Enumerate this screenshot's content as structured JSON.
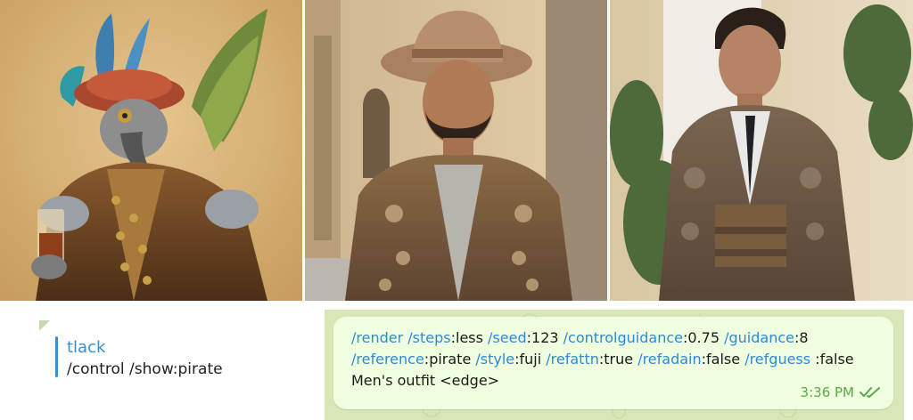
{
  "images": {
    "left": {
      "alt": "pirate-parrot"
    },
    "middle": {
      "alt": "man-with-hat"
    },
    "right": {
      "alt": "man-in-suit"
    }
  },
  "quote": {
    "author": "tlack",
    "text": "/control /show:pirate"
  },
  "message": {
    "parts": [
      {
        "t": "/render ",
        "cmd": true
      },
      {
        "t": "/steps",
        "cmd": true
      },
      {
        "t": ":less ",
        "cmd": false
      },
      {
        "t": "/seed",
        "cmd": true
      },
      {
        "t": ":123 ",
        "cmd": false
      },
      {
        "t": "/controlguidance",
        "cmd": true
      },
      {
        "t": ":0.75 ",
        "cmd": false
      },
      {
        "t": "/guidance",
        "cmd": true
      },
      {
        "t": ":8 ",
        "cmd": false
      },
      {
        "t": "/reference",
        "cmd": true
      },
      {
        "t": ":pirate ",
        "cmd": false
      },
      {
        "t": "/style",
        "cmd": true
      },
      {
        "t": ":fuji ",
        "cmd": false
      },
      {
        "t": "/refattn",
        "cmd": true
      },
      {
        "t": ":true ",
        "cmd": false
      },
      {
        "t": "/refadain",
        "cmd": true
      },
      {
        "t": ":false ",
        "cmd": false
      },
      {
        "t": "/refguess",
        "cmd": true
      },
      {
        "t": " :false Men's outfit <edge>",
        "cmd": false
      }
    ],
    "time": "3:36 PM",
    "status_icon": "double-check-icon"
  },
  "colors": {
    "command": "#2e8ad8",
    "bubble": "#eefedf",
    "time": "#5ea84b",
    "quote_accent": "#3a8ed1"
  }
}
